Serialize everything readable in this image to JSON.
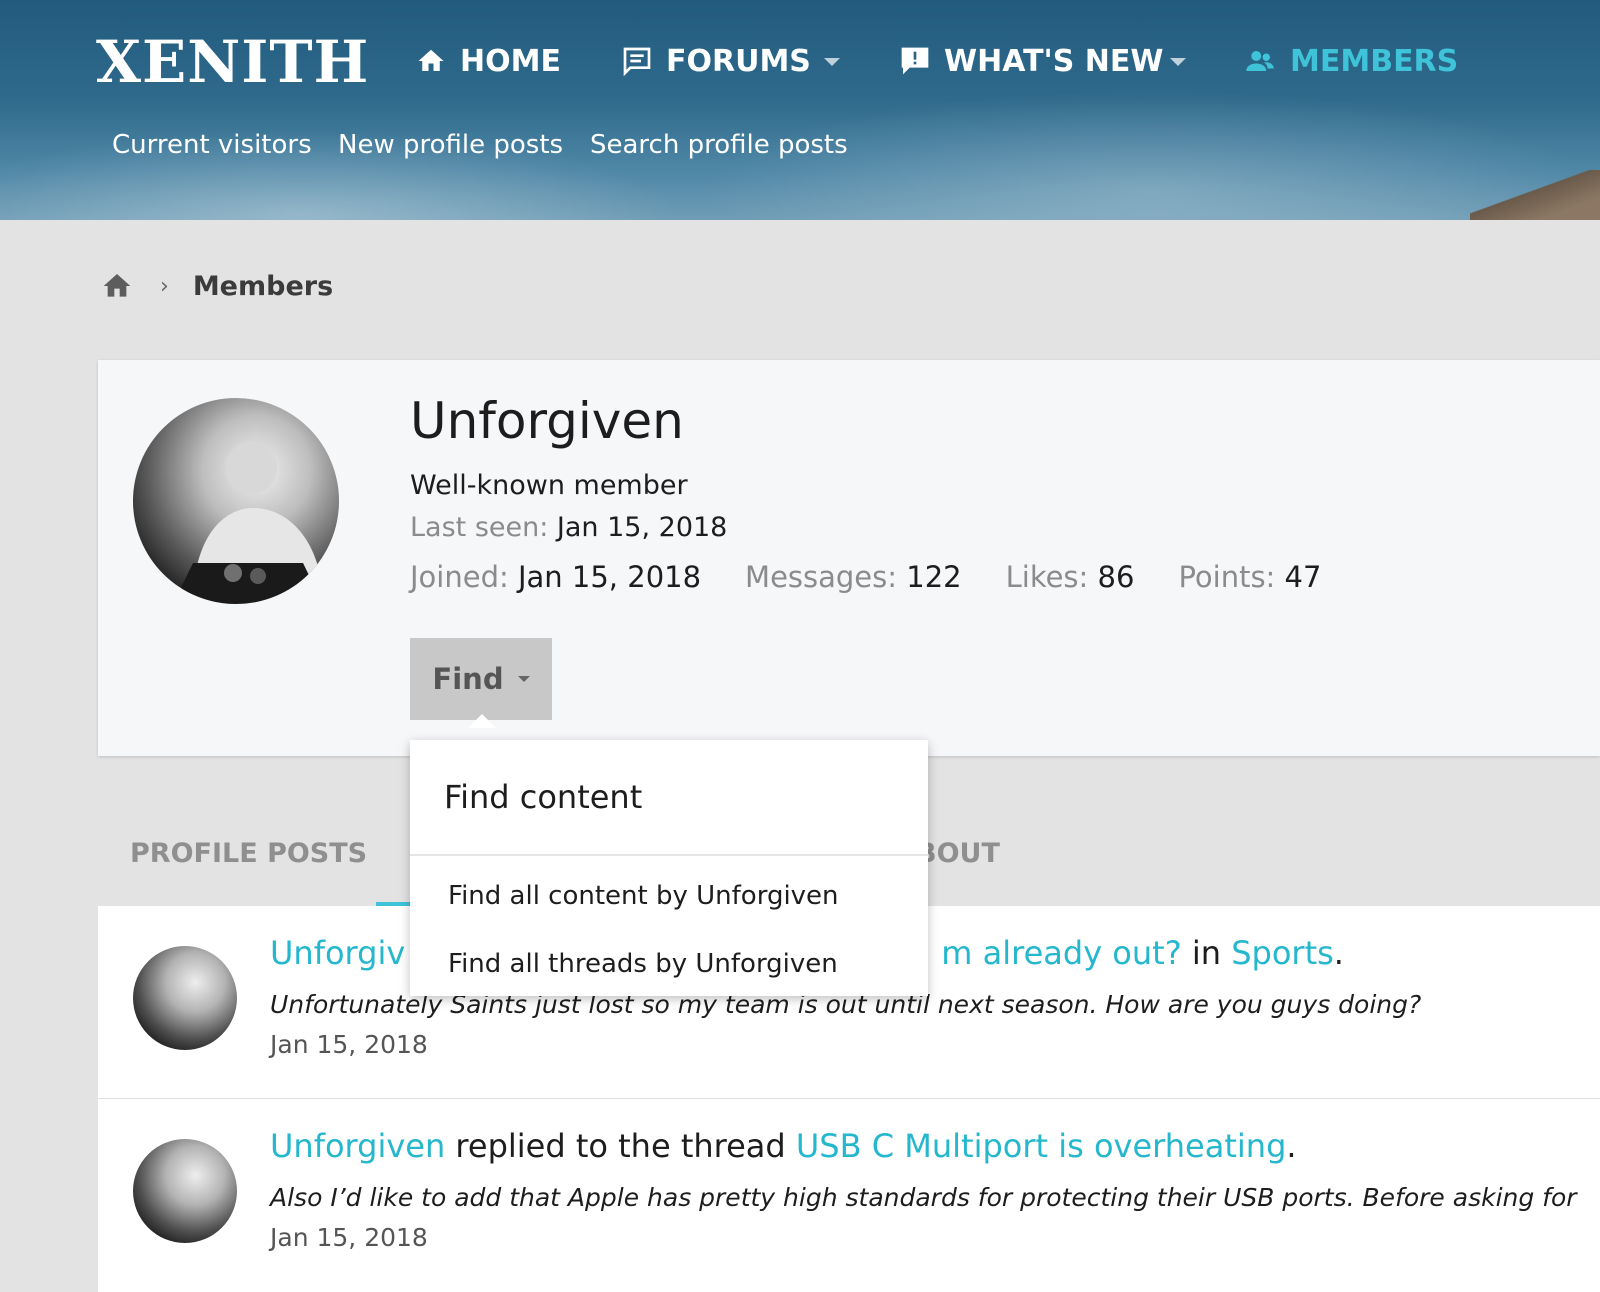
{
  "header": {
    "logo": "XENITH",
    "nav": [
      {
        "label": "HOME",
        "icon": "home-icon"
      },
      {
        "label": "FORUMS",
        "icon": "forum-icon",
        "dropdown": true
      },
      {
        "label": "WHAT'S NEW",
        "icon": "whats-new-icon",
        "dropdown": true
      },
      {
        "label": "MEMBERS",
        "icon": "members-icon",
        "active": true
      }
    ],
    "subnav": [
      "Current visitors",
      "New profile posts",
      "Search profile posts"
    ]
  },
  "breadcrumb": {
    "home_icon": "home-icon",
    "items": [
      "Members"
    ]
  },
  "profile": {
    "username": "Unforgiven",
    "user_title": "Well-known member",
    "last_seen_label": "Last seen:",
    "last_seen_value": "Jan 15, 2018",
    "stats": [
      {
        "label": "Joined:",
        "value": "Jan 15, 2018"
      },
      {
        "label": "Messages:",
        "value": "122"
      },
      {
        "label": "Likes:",
        "value": "86"
      },
      {
        "label": "Points:",
        "value": "47"
      }
    ],
    "find_button": "Find"
  },
  "find_menu": {
    "header": "Find content",
    "items": [
      "Find all content by Unforgiven",
      "Find all threads by Unforgiven"
    ]
  },
  "tabs": [
    "PROFILE POSTS",
    "BOUT"
  ],
  "posts": [
    {
      "user": "Unforgiv",
      "mid_text": "",
      "thread": "m already out?",
      "in_text": " in ",
      "forum": "Sports",
      "end": ".",
      "snippet": "Unfortunately Saints just lost so my team is out until next season. How are you guys doing?",
      "date": "Jan 15, 2018"
    },
    {
      "user": "Unforgiven",
      "mid_text": " replied to the thread ",
      "thread": "USB C Multiport is overheating",
      "in_text": "",
      "forum": "",
      "end": ".",
      "snippet": "Also I’d like to add that Apple has pretty high standards for protecting their USB ports. Before asking for",
      "date": "Jan 15, 2018"
    }
  ],
  "colors": {
    "accent": "#3ec3d9",
    "link": "#25b7cd",
    "header_bg": "#215a7c",
    "find_button_bg": "#c8c8c8"
  }
}
